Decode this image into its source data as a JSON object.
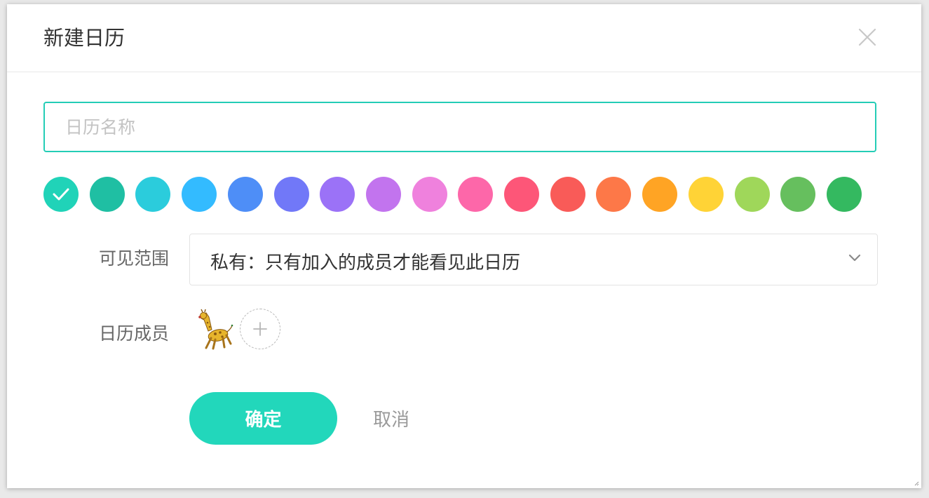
{
  "dialog": {
    "title": "新建日历",
    "close_icon": "close-icon"
  },
  "name_input": {
    "placeholder": "日历名称",
    "value": ""
  },
  "color_picker": {
    "selected_index": 0,
    "colors": [
      "#20d3b8",
      "#1fbfa3",
      "#2bccdc",
      "#33bbff",
      "#4e8ef7",
      "#7178f8",
      "#9b72f7",
      "#c274ee",
      "#ef81dd",
      "#fd67a9",
      "#fd5678",
      "#f95b58",
      "#fd7848",
      "#ffa424",
      "#ffd336",
      "#9fd75a",
      "#66bf5e",
      "#34b960"
    ],
    "check_icon": "check-icon"
  },
  "visibility": {
    "label": "可见范围",
    "selected": "私有：只有加入的成员才能看见此日历",
    "dropdown_icon": "chevron-down-icon"
  },
  "members": {
    "label": "日历成员",
    "avatar_icon": "giraffe-avatar",
    "add_icon": "plus-icon"
  },
  "actions": {
    "confirm": "确定",
    "cancel": "取消"
  },
  "theme": {
    "accent": "#22d7bb",
    "input_border": "#24cdb6"
  }
}
